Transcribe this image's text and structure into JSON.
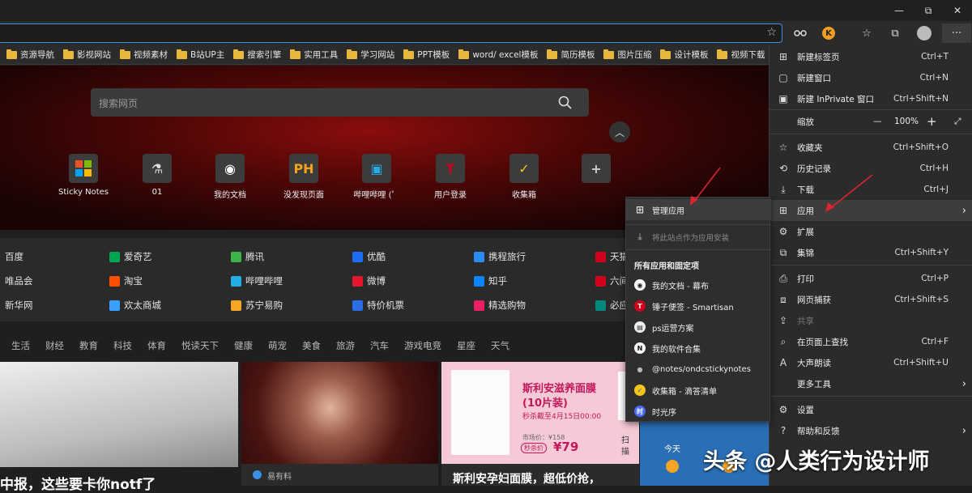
{
  "window": {
    "minimize": "—",
    "restore": "⧉",
    "close": "✕"
  },
  "toolbar": {
    "favorite_icon": "star-plus-icon",
    "more": "···"
  },
  "bookmarks": [
    "资源导航",
    "影视网站",
    "视频素材",
    "B站UP主",
    "搜索引擎",
    "实用工具",
    "学习网站",
    "PPT模板",
    "word/ excel模板",
    "简历模板",
    "图片压缩",
    "设计模板",
    "视频下载"
  ],
  "search": {
    "placeholder": "搜索网页"
  },
  "tiles": [
    {
      "label": "Sticky Notes",
      "glyph": "",
      "color": "#ffffff"
    },
    {
      "label": "01",
      "glyph": "⚗",
      "color": "#dddddd"
    },
    {
      "label": "我的文档",
      "glyph": "◉",
      "color": "#ffffff"
    },
    {
      "label": "没发现页面",
      "glyph": "PH",
      "color": "#f7a21b"
    },
    {
      "label": "哔哩哔哩 (゜",
      "glyph": "▣",
      "color": "#23ade5"
    },
    {
      "label": "用户登录",
      "glyph": "T",
      "color": "#d0021b"
    },
    {
      "label": "收集箱",
      "glyph": "✓",
      "color": "#f5c518"
    },
    {
      "label": "",
      "glyph": "+",
      "color": "#cccccc"
    }
  ],
  "quick_links": [
    [
      "百度",
      "爱奇艺",
      "腾讯",
      "优酷",
      "携程旅行",
      "天猫"
    ],
    [
      "唯品会",
      "淘宝",
      "哔哩哔哩",
      "微博",
      "知乎",
      "六间"
    ],
    [
      "新华网",
      "欢太商城",
      "苏宁易购",
      "特价机票",
      "精选购物",
      "必应"
    ]
  ],
  "categories": [
    "生活",
    "财经",
    "教育",
    "科技",
    "体育",
    "悦读天下",
    "健康",
    "萌宠",
    "美食",
    "旅游",
    "汽车",
    "游戏电竞",
    "星座",
    "天气"
  ],
  "cards": {
    "card1_title": "中报，这些要卡你notf了",
    "card2_source": "易有料",
    "card3_title": "斯利安孕妇面膜，超低价抢，",
    "ad_title": "斯利安滋养面膜",
    "ad_sub": "(10片装)",
    "ad_time": "秒杀截至4月15日00:00",
    "ad_market": "市场价：¥158",
    "ad_price_tag": "秒杀价",
    "ad_price": "¥79",
    "ad_side": "扫",
    "ad_side2": "描",
    "weather_today": "今天"
  },
  "menu": {
    "items": [
      {
        "label": "新建标签页",
        "key": "Ctrl+T",
        "icon": "new-tab-icon"
      },
      {
        "label": "新建窗口",
        "key": "Ctrl+N",
        "icon": "new-window-icon"
      },
      {
        "label": "新建 InPrivate 窗口",
        "key": "Ctrl+Shift+N",
        "icon": "inprivate-icon"
      },
      {
        "label": "收藏夹",
        "key": "Ctrl+Shift+O",
        "icon": "favorites-icon"
      },
      {
        "label": "历史记录",
        "key": "Ctrl+H",
        "icon": "history-icon"
      },
      {
        "label": "下载",
        "key": "Ctrl+J",
        "icon": "download-icon"
      },
      {
        "label": "应用",
        "key": "",
        "icon": "apps-icon"
      },
      {
        "label": "扩展",
        "key": "",
        "icon": "extensions-icon"
      },
      {
        "label": "集锦",
        "key": "Ctrl+Shift+Y",
        "icon": "collections-icon"
      },
      {
        "label": "打印",
        "key": "Ctrl+P",
        "icon": "print-icon"
      },
      {
        "label": "网页捕获",
        "key": "Ctrl+Shift+S",
        "icon": "capture-icon"
      },
      {
        "label": "共享",
        "key": "",
        "icon": "share-icon"
      },
      {
        "label": "在页面上查找",
        "key": "Ctrl+F",
        "icon": "find-icon"
      },
      {
        "label": "大声朗读",
        "key": "Ctrl+Shift+U",
        "icon": "read-aloud-icon"
      },
      {
        "label": "更多工具",
        "key": "",
        "icon": ""
      },
      {
        "label": "设置",
        "key": "",
        "icon": "settings-icon"
      },
      {
        "label": "帮助和反馈",
        "key": "",
        "icon": "help-icon"
      }
    ],
    "zoom_label": "缩放",
    "zoom_value": "100%",
    "zoom_minus": "—",
    "zoom_plus": "+"
  },
  "submenu": {
    "manage": "管理应用",
    "install": "将此站点作为应用安装",
    "section": "所有应用和固定项",
    "apps": [
      {
        "label": "我的文档 - 幕布",
        "glyph": "◉",
        "bg": "#ffffff",
        "fg": "#222222"
      },
      {
        "label": "锤子便签 - Smartisan",
        "glyph": "T",
        "bg": "#d0021b",
        "fg": "#ffffff"
      },
      {
        "label": "ps运营方案",
        "glyph": "▤",
        "bg": "#eeeeee",
        "fg": "#333333"
      },
      {
        "label": "我的软件合集",
        "glyph": "N",
        "bg": "#ffffff",
        "fg": "#111111"
      },
      {
        "label": "@notes/ondcstickynotes",
        "glyph": "●",
        "bg": "#2e2e2e",
        "fg": "#bbbbbb"
      },
      {
        "label": "收集箱 - 滴答清单",
        "glyph": "✓",
        "bg": "#f5c518",
        "fg": "#1a56db"
      },
      {
        "label": "时光序",
        "glyph": "时",
        "bg": "#4a6cf7",
        "fg": "#ffffff"
      }
    ]
  },
  "watermark": "头条 @人类行为设计师",
  "colors": {
    "accent": "#3a8ee6",
    "arrow": "#e0242c",
    "folder": "#e8b83a"
  }
}
